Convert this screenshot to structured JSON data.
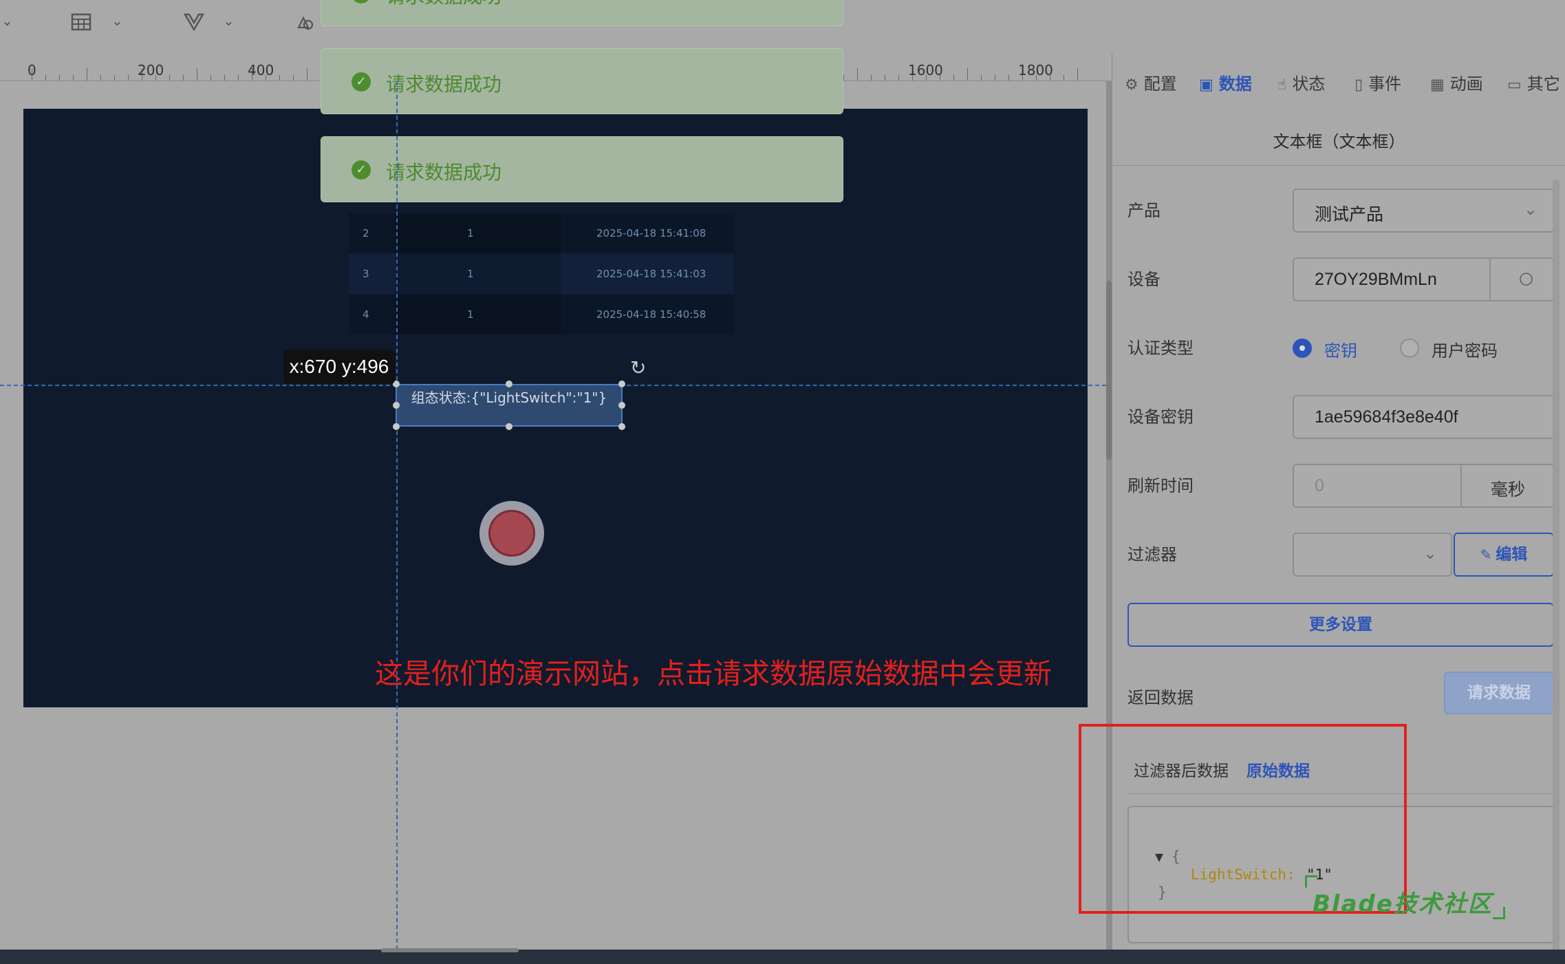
{
  "toolbar": {
    "icons": [
      "table-icon",
      "vue-icon",
      "shapes-icon"
    ]
  },
  "ruler": {
    "labels": [
      "0",
      "200",
      "400",
      "1600",
      "1800"
    ]
  },
  "toasts": [
    {
      "text": "请求数据成功"
    },
    {
      "text": "请求数据成功"
    },
    {
      "text": "请求数据成功"
    }
  ],
  "table": {
    "rows": [
      {
        "idx": "2",
        "value": "1",
        "time": "2025-04-18 15:41:08"
      },
      {
        "idx": "3",
        "value": "1",
        "time": "2025-04-18 15:41:03"
      },
      {
        "idx": "4",
        "value": "1",
        "time": "2025-04-18 15:40:58"
      }
    ]
  },
  "selected": {
    "text": "组态状态:{\"LightSwitch\":\"1\"}",
    "coord": "x:670 y:496"
  },
  "annotation": "这是你们的演示网站，点击请求数据原始数据中会更新",
  "panel": {
    "tabs": [
      {
        "label": "配置",
        "icon": "gear-icon",
        "active": false
      },
      {
        "label": "数据",
        "icon": "data-icon",
        "active": true
      },
      {
        "label": "状态",
        "icon": "hand-icon",
        "active": false
      },
      {
        "label": "事件",
        "icon": "mouse-icon",
        "active": false
      },
      {
        "label": "动画",
        "icon": "grid-icon",
        "active": false
      },
      {
        "label": "其它",
        "icon": "folder-icon",
        "active": false
      }
    ],
    "title": "文本框（文本框）",
    "fields": {
      "product_label": "产品",
      "product_value": "测试产品",
      "device_label": "设备",
      "device_value": "27OY29BMmLn",
      "auth_label": "认证类型",
      "auth_opt1": "密钥",
      "auth_opt2": "用户密码",
      "secret_label": "设备密钥",
      "secret_value": "1ae59684f3e8e40f",
      "refresh_label": "刷新时间",
      "refresh_placeholder": "0",
      "refresh_unit": "毫秒",
      "filter_label": "过滤器",
      "edit_btn": "编辑",
      "more_btn": "更多设置",
      "return_label": "返回数据",
      "request_btn": "请求数据"
    },
    "data_tabs": {
      "filtered": "过滤器后数据",
      "raw": "原始数据"
    },
    "json": {
      "open": "{",
      "key": "LightSwitch:",
      "value": "\"1\"",
      "close": "}"
    }
  },
  "watermark": "Blade技术社区",
  "colors": {
    "canvas_bg": "#0f1b2d",
    "accent": "#2d55b8",
    "annotation_red": "#e3201c",
    "toast_green": "#4d8a2e"
  }
}
